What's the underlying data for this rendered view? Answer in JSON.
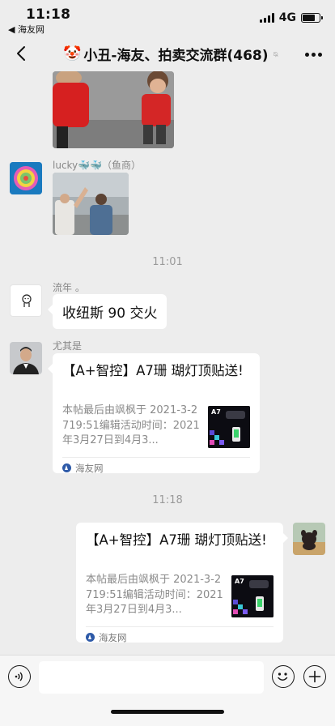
{
  "status_bar": {
    "time": "11:18",
    "back_app": "◀ 海友网",
    "network": "4G",
    "battery_level": 0.75
  },
  "nav": {
    "title_emoji": "🤡",
    "title": "小丑-海友、拍卖交流群(468)",
    "icons": [
      "back-arrow-icon",
      "mute-bell-icon",
      "more-icon"
    ]
  },
  "messages": [
    {
      "type": "image",
      "side": "left",
      "description_icon": "photo"
    },
    {
      "type": "image",
      "side": "left",
      "sender": "lucky🐳🐳（鱼商）"
    },
    {
      "type": "time",
      "text": "11:01"
    },
    {
      "type": "text",
      "side": "left",
      "sender": "流年 。",
      "text": "收纽斯 90 交火"
    },
    {
      "type": "link_card",
      "side": "left",
      "sender": "尤其是",
      "title": "【A+智控】A7珊 瑚灯顶贴送!",
      "desc": "本帖最后由飒枫于 2021-3-2719:51编辑活动时间：2021年3月27日到4月3...",
      "thumb_label": "A7",
      "source": "海友网"
    },
    {
      "type": "time",
      "text": "11:18"
    },
    {
      "type": "link_card",
      "side": "right",
      "title": "【A+智控】A7珊 瑚灯顶贴送!",
      "desc": "本帖最后由飒枫于 2021-3-2719:51编辑活动时间：2021年3月27日到4月3...",
      "thumb_label": "A7",
      "source": "海友网"
    }
  ],
  "input_bar": {
    "placeholder": "",
    "icons": [
      "voice-icon",
      "emoji-icon",
      "plus-icon"
    ]
  },
  "colors": {
    "background": "#ededed",
    "bubble": "#ffffff",
    "meta_text": "#888888"
  }
}
